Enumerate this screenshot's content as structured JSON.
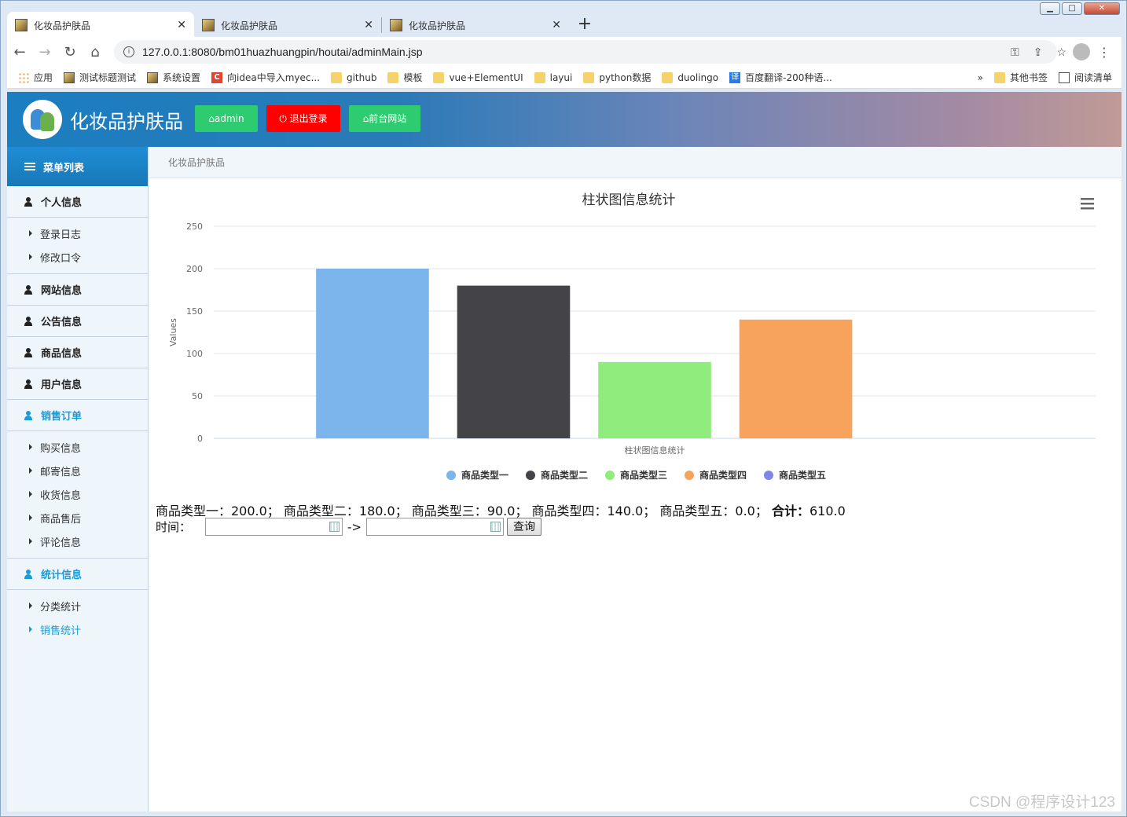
{
  "browser": {
    "tabs": [
      {
        "title": "化妆品护肤品",
        "active": true
      },
      {
        "title": "化妆品护肤品",
        "active": false
      },
      {
        "title": "化妆品护肤品",
        "active": false
      }
    ],
    "new_tab": "+",
    "url": "127.0.0.1:8080/bm01huazhuangpin/houtai/adminMain.jsp",
    "bookmarks": [
      {
        "label": "应用",
        "icon": "apps-icon"
      },
      {
        "label": "测试标题测试",
        "icon": "page-icon"
      },
      {
        "label": "系统设置",
        "icon": "page-icon"
      },
      {
        "label": "向idea中导入myec...",
        "icon": "c-icon"
      },
      {
        "label": "github",
        "icon": "folder-icon"
      },
      {
        "label": "模板",
        "icon": "folder-icon"
      },
      {
        "label": "vue+ElementUI",
        "icon": "folder-icon"
      },
      {
        "label": "layui",
        "icon": "folder-icon"
      },
      {
        "label": "python数据",
        "icon": "folder-icon"
      },
      {
        "label": "duolingo",
        "icon": "folder-icon"
      },
      {
        "label": "百度翻译-200种语...",
        "icon": "translate-icon"
      }
    ],
    "bookmarks_overflow": "»",
    "other_bookmarks": "其他书签",
    "reading_list": "阅读清单"
  },
  "header": {
    "site_title": "化妆品护肤品",
    "admin_button": "admin",
    "logout_button": "退出登录",
    "frontend_button": "前台网站",
    "colors": {
      "green": "#2ecc71",
      "red": "#ff0000"
    }
  },
  "sidebar": {
    "title": "菜单列表",
    "groups": [
      {
        "label": "个人信息",
        "items": [
          "登录日志",
          "修改口令"
        ]
      },
      {
        "label": "网站信息",
        "items": []
      },
      {
        "label": "公告信息",
        "items": []
      },
      {
        "label": "商品信息",
        "items": []
      },
      {
        "label": "用户信息",
        "items": []
      },
      {
        "label": "销售订单",
        "items": [
          "购买信息",
          "邮寄信息",
          "收货信息",
          "商品售后",
          "评论信息"
        ]
      },
      {
        "label": "统计信息",
        "items": [
          "分类统计",
          "销售统计"
        ]
      }
    ],
    "active_item": "销售统计"
  },
  "breadcrumb": "化妆品护肤品",
  "chart_data": {
    "type": "bar",
    "title": "柱状图信息统计",
    "xlabel": "柱状图信息统计",
    "ylabel": "Values",
    "ylim": [
      0,
      250
    ],
    "yticks": [
      "0",
      "50",
      "100",
      "150",
      "200",
      "250"
    ],
    "grid": true,
    "legend_position": "bottom",
    "series": [
      {
        "name": "商品类型一",
        "values": [
          200
        ],
        "color": "#7cb5ec"
      },
      {
        "name": "商品类型二",
        "values": [
          180
        ],
        "color": "#434348"
      },
      {
        "name": "商品类型三",
        "values": [
          90
        ],
        "color": "#90ed7d"
      },
      {
        "name": "商品类型四",
        "values": [
          140
        ],
        "color": "#f7a35c"
      },
      {
        "name": "商品类型五",
        "values": [
          0
        ],
        "color": "#8085e9"
      }
    ]
  },
  "summary": {
    "text": "商品类型一：200.0；  商品类型二：180.0；  商品类型三：90.0；  商品类型四：140.0；  商品类型五：0.0；",
    "total_label": "合计：",
    "total_value": "610.0"
  },
  "filter": {
    "time_label": "时间：",
    "start_value": "",
    "arrow": "->",
    "end_value": "",
    "query_button": "查询"
  },
  "watermark": "CSDN @程序设计123"
}
